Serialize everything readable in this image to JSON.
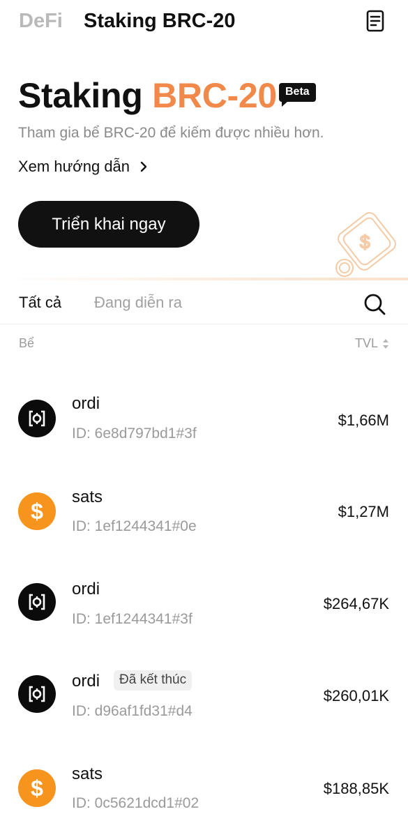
{
  "header": {
    "tab_defi": "DeFi",
    "tab_staking": "Staking BRC-20",
    "doc_icon": "document-icon"
  },
  "hero": {
    "title_main": "Staking",
    "title_accent": "BRC-20",
    "beta_label": "Beta",
    "subtitle": "Tham gia bể BRC-20 để kiếm được nhiều hơn.",
    "guide_link": "Xem hướng dẫn",
    "cta_label": "Triển khai ngay",
    "accent_color": "#f0894a"
  },
  "filters": {
    "all": "Tất cả",
    "active": "Đang diễn ra",
    "search_icon": "search-icon"
  },
  "columns": {
    "pool": "Bể",
    "tvl": "TVL"
  },
  "pools": [
    {
      "name": "ordi",
      "id": "ID: 6e8d797bd1#3f",
      "tvl": "$1,66M",
      "icon": "ordi-icon",
      "badge": ""
    },
    {
      "name": "sats",
      "id": "ID: 1ef1244341#0e",
      "tvl": "$1,27M",
      "icon": "sats-icon",
      "badge": ""
    },
    {
      "name": "ordi",
      "id": "ID: 1ef1244341#3f",
      "tvl": "$264,67K",
      "icon": "ordi-icon",
      "badge": ""
    },
    {
      "name": "ordi",
      "id": "ID: d96af1fd31#d4",
      "tvl": "$260,01K",
      "icon": "ordi-icon",
      "badge": "Đã kết thúc"
    },
    {
      "name": "sats",
      "id": "ID: 0c5621dcd1#02",
      "tvl": "$188,85K",
      "icon": "sats-icon",
      "badge": ""
    }
  ]
}
